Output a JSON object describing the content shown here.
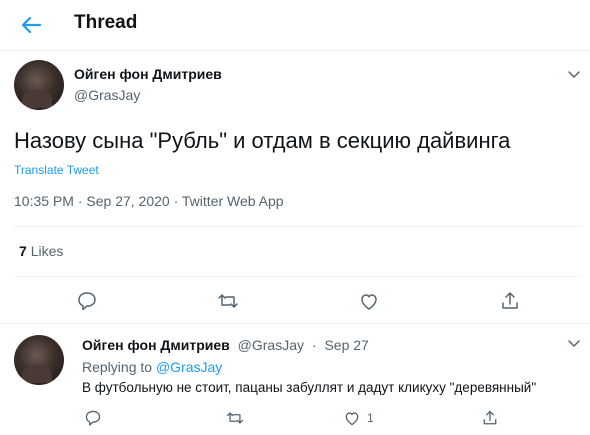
{
  "header": {
    "title": "Thread"
  },
  "tweet": {
    "author_name": "Ойген фон Дмитриев",
    "author_handle": "@GrasJay",
    "text": "Назову сына \"Рубль\" и отдам в секцию дайвинга",
    "translate_label": "Translate Tweet",
    "time": "10:35 PM",
    "date": "Sep 27, 2020",
    "source": "Twitter Web App",
    "meta_sep": "·",
    "likes_count": "7",
    "likes_label": "Likes"
  },
  "reply": {
    "author_name": "Ойген фон Дмитриев",
    "author_handle": "@GrasJay",
    "dot": "·",
    "date": "Sep 27",
    "replying_prefix": "Replying to",
    "replying_handle": "@GrasJay",
    "text": "В футбольную не стоит, пацаны забуллят и дадут кликуху \"деревянный\"",
    "likes_count": "1"
  },
  "colors": {
    "accent": "#1d9bf0",
    "text": "#0f1419",
    "muted": "#536471",
    "divider": "#eff3f4"
  },
  "icons": [
    "back-arrow-icon",
    "chevron-down-icon",
    "reply-icon",
    "retweet-icon",
    "like-icon",
    "share-icon"
  ]
}
